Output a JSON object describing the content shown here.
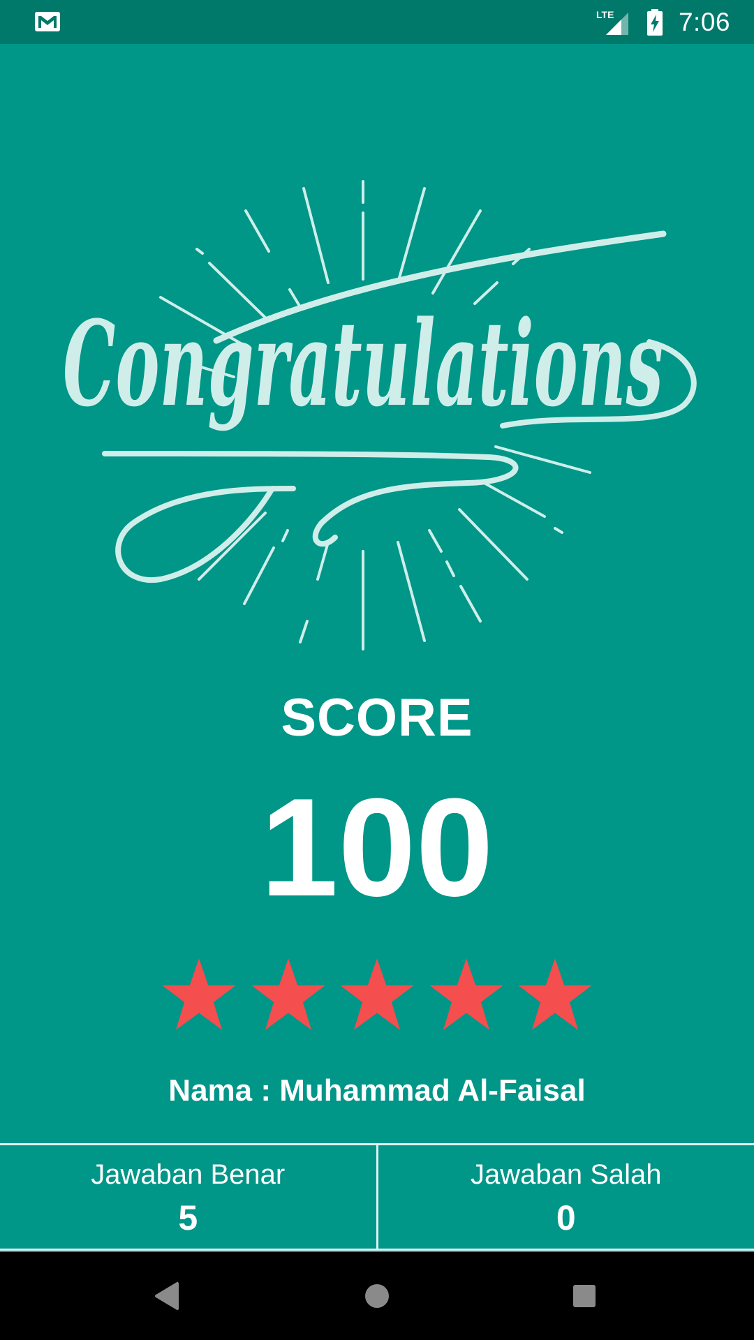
{
  "status_bar": {
    "network_label": "LTE",
    "time": "7:06",
    "icons": [
      "gmail-icon",
      "lte-signal-icon",
      "battery-charging-icon"
    ]
  },
  "hero": {
    "text": "Congratulations"
  },
  "result": {
    "score_label": "SCORE",
    "score_value": "100",
    "stars": 5,
    "stars_max": 5,
    "star_color": "#f44e4e",
    "name_line": "Nama : Muhammad Al-Faisal"
  },
  "answers": {
    "correct": {
      "label": "Jawaban Benar",
      "count": "5"
    },
    "wrong": {
      "label": "Jawaban Salah",
      "count": "0"
    }
  },
  "nav": {
    "buttons": [
      "back-icon",
      "home-icon",
      "recents-icon"
    ]
  },
  "colors": {
    "background": "#009688",
    "status_bar": "#00796b",
    "text": "#ffffff",
    "lettering": "#cfeeea"
  }
}
